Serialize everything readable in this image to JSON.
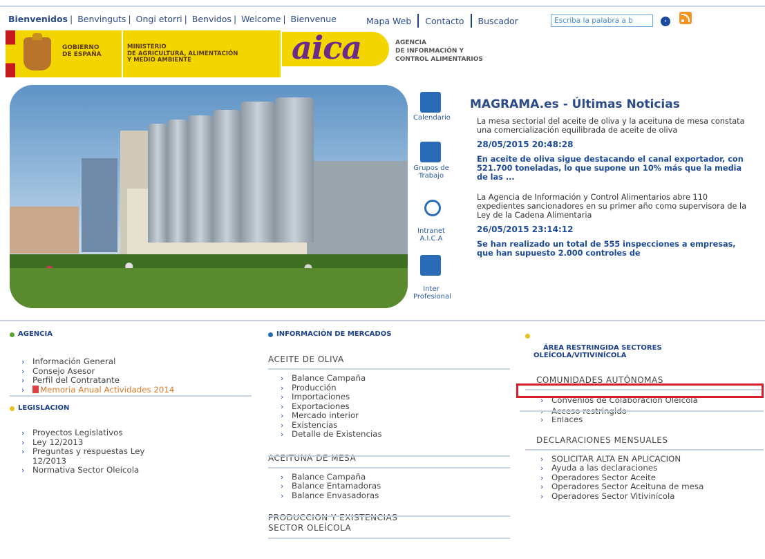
{
  "lang_bar": {
    "items": [
      "Bienvenidos",
      "Benvinguts",
      "Ongi etorri",
      "Benvidos",
      "Welcome",
      "Bienvenue"
    ]
  },
  "top_nav": {
    "mapa": "Mapa Web",
    "contacto": "Contacto",
    "buscador": "Buscador",
    "search_placeholder": "Escriba la palabra a b",
    "go": "›"
  },
  "banner": {
    "gobierno": "GOBIERNO\nDE ESPAÑA",
    "ministerio": "MINISTERIO\nDE AGRICULTURA, ALIMENTACIÓN\nY MEDIO AMBIENTE",
    "aica": "aica",
    "aica_sub": "AGENCIA\nDE INFORMACIÓN Y\nCONTROL ALIMENTARIOS"
  },
  "side_icons": [
    {
      "label": "Calendario"
    },
    {
      "label": "Grupos de\nTrabajo"
    },
    {
      "label": "Intranet\nA.I.C.A"
    },
    {
      "label": "Inter\nProfesional"
    }
  ],
  "news": {
    "title": "MAGRAMA.es - Últimas Noticias",
    "p1": "La mesa sectorial del aceite de oliva y la aceituna de mesa constata una comercialización equilibrada de aceite de oliva",
    "d1": "28/05/2015 20:48:28",
    "h1": "En aceite de oliva sigue destacando el canal exportador, con 521.700 toneladas, lo que supone un 10% más que la media de las ...",
    "p2": "La Agencia de Información y Control Alimentarios abre 110 expedientes sancionadores en su primer año como supervisora de la Ley de la Cadena Alimentaria",
    "d2": "26/05/2015 23:14:12",
    "h2": "Se han realizado un total de 555 inspecciones a empresas, que han supuesto 2.000 controles de"
  },
  "agencia": {
    "title": "AGENCIA",
    "items": [
      "Información General",
      "Consejo Asesor",
      "Perfil del Contratante",
      "Memoria Anual Actividades 2014"
    ]
  },
  "legislacion": {
    "title": "LEGISLACION",
    "items": [
      "Proyectos Legislativos",
      "Ley 12/2013",
      "Preguntas y respuestas Ley 12/2013",
      "Normativa Sector Oleícola"
    ]
  },
  "mercados": {
    "title": "INFORMACIÓN DE MERCADOS",
    "aceite": {
      "title": "ACEITE DE OLIVA",
      "items": [
        "Balance Campaña",
        "Producción",
        "Importaciones",
        "Exportaciones",
        "Mercado interior",
        "Existencias",
        "Detalle de Existencias"
      ]
    },
    "aceituna": {
      "title": "ACEITUNA DE MESA",
      "items": [
        "Balance Campaña",
        "Balance Entamadoras",
        "Balance Envasadoras"
      ]
    },
    "produccion": {
      "title": "PRODUCCION Y EXISTENCIAS\nSECTOR OLEÍCOLA"
    }
  },
  "restringida": {
    "title": "ÁREA RESTRINGIDA SECTORES\nOLEÍCOLA/VITIVINÍCOLA",
    "ccaa": {
      "title": "COMUNIDADES AUTÓNOMAS",
      "items": [
        "Convenios de Colaboración Oleícola",
        "Acceso restringido",
        "Enlaces"
      ]
    },
    "declaraciones": {
      "title": "DECLARACIONES MENSUALES",
      "items": [
        "SOLICITAR ALTA EN APLICACION",
        "Ayuda a las declaraciones",
        "Operadores Sector Aceite",
        "Operadores Sector Aceituna de mesa",
        "Operadores Sector Vitivinícola"
      ]
    }
  },
  "colors": {
    "link": "#2b4a8a",
    "dot_green": "#5aa832",
    "dot_yellow": "#e8c020",
    "dot_blue": "#2a6cb8",
    "highlight": "#d81c2a"
  }
}
